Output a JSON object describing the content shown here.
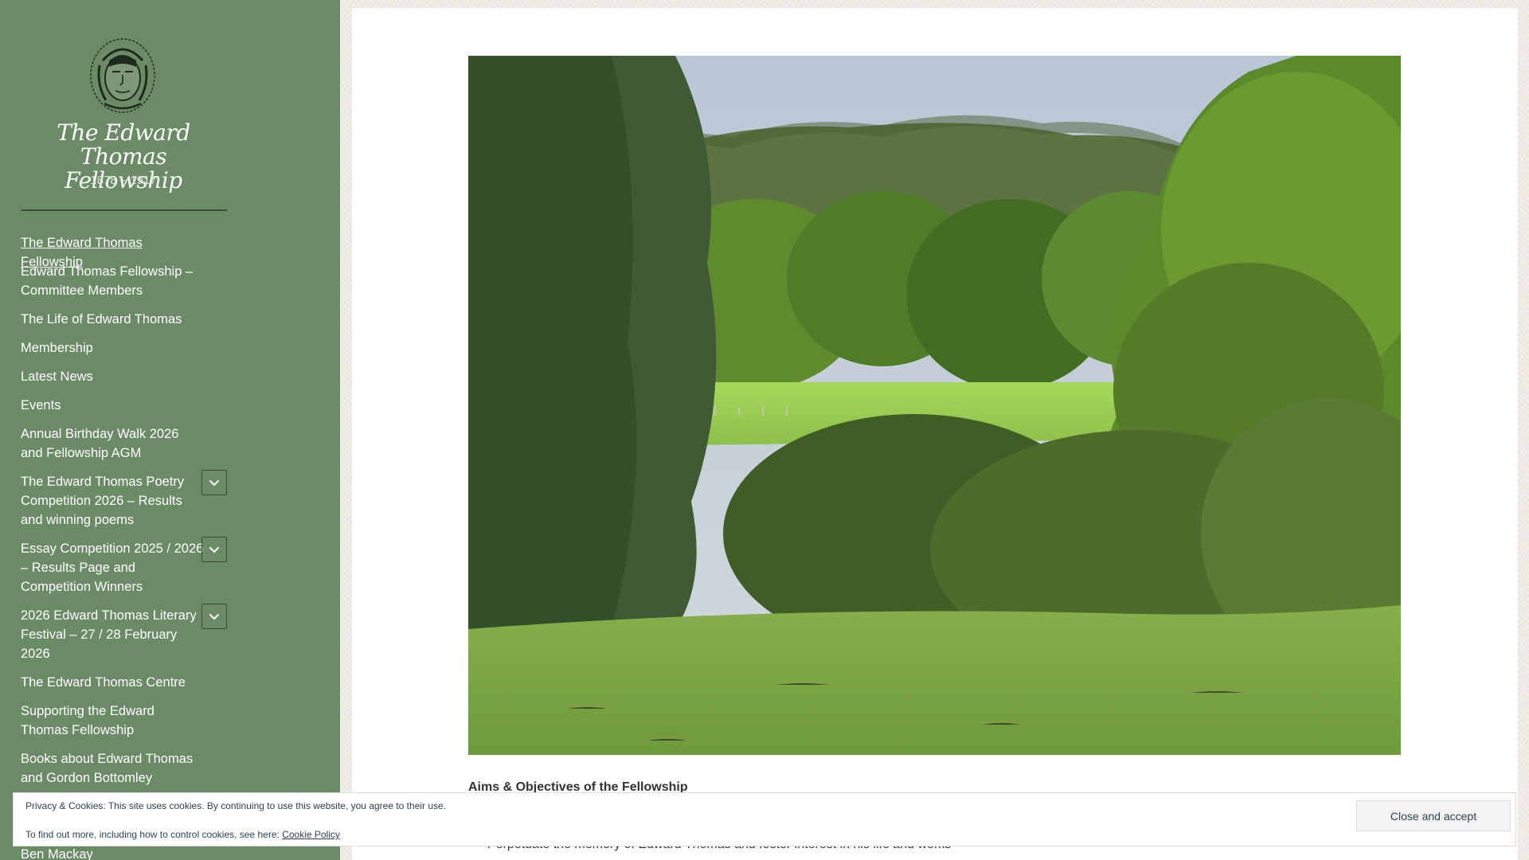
{
  "site": {
    "title": "The Edward Thomas Fellowship",
    "tagline": "1878 – 1917"
  },
  "nav": {
    "items": [
      {
        "label": "The Edward Thomas Fellowship",
        "current": true,
        "has_submenu": false
      },
      {
        "label": "Edward Thomas Fellowship – Committee Members",
        "has_submenu": false
      },
      {
        "label": "The Life of Edward Thomas",
        "has_submenu": false
      },
      {
        "label": "Membership",
        "has_submenu": false
      },
      {
        "label": "Latest News",
        "has_submenu": false
      },
      {
        "label": "Events",
        "has_submenu": false
      },
      {
        "label": "Annual Birthday Walk 2026 and Fellowship AGM",
        "has_submenu": false
      },
      {
        "label": "The Edward Thomas Poetry Competition 2026 – Results and winning poems",
        "has_submenu": true
      },
      {
        "label": "Essay Competition 2025 / 2026 – Results Page and Competition Winners",
        "has_submenu": true
      },
      {
        "label": "2026 Edward Thomas Literary Festival – 27 / 28 February 2026",
        "has_submenu": true
      },
      {
        "label": "The Edward Thomas Centre",
        "has_submenu": false
      },
      {
        "label": "Supporting the Edward Thomas Fellowship",
        "has_submenu": false
      },
      {
        "label": "Books about Edward Thomas and Gordon Bottomley",
        "has_submenu": false
      },
      {
        "label": "Ben Mackay",
        "has_submenu": false
      }
    ]
  },
  "main": {
    "section_heading": "Aims & Objectives of the Fellowship",
    "objectives": [
      "Perpetuate the memory of Edward Thomas and foster interest in his life and works"
    ]
  },
  "cookie_bar": {
    "notice": "Privacy & Cookies: This site uses cookies. By continuing to use this website, you agree to their use.",
    "more_info": "To find out more, including how to control cookies, see here:",
    "policy_link": "Cookie Policy",
    "accept_label": "Close and accept"
  },
  "colors": {
    "sidebar_bg": "#6b8a66",
    "page_bg": "#f1efe8",
    "text": "#2b2b2b",
    "cookie_text": "#2e4453"
  },
  "icons": {
    "logo": "portrait-sketch-logo",
    "submenu_toggle": "chevron-down-icon"
  }
}
